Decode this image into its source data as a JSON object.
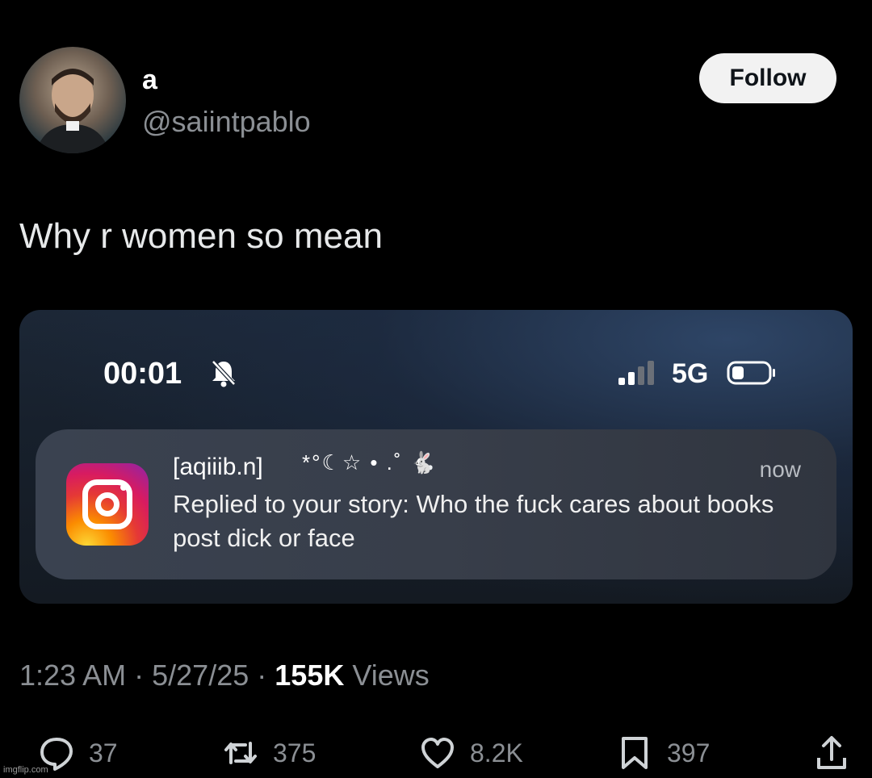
{
  "author": {
    "display_name": "a",
    "handle": "@saiintpablo",
    "follow_label": "Follow"
  },
  "tweet": {
    "text": "Why r women so mean"
  },
  "media": {
    "status_time": "00:01",
    "network": "5G",
    "notification": {
      "app": "Instagram",
      "sender": "[aqiiib.n]",
      "decoration": "*°☾☆ • .˚ 🐇",
      "time": "now",
      "body": "Replied to your story: Who the fuck cares about books post dick or face"
    }
  },
  "meta": {
    "time": "1:23 AM",
    "sep1": "·",
    "date": "5/27/25",
    "sep2": "·",
    "views_count": "155K",
    "views_label": "Views"
  },
  "actions": {
    "replies": "37",
    "reposts": "375",
    "likes": "8.2K",
    "bookmarks": "397"
  },
  "watermark": "imgflip.com",
  "colors": {
    "background": "#000000",
    "text_primary": "#e7e9ea",
    "text_secondary": "#8b8f94",
    "follow_bg": "#f2f2f2"
  },
  "icons": [
    "avatar-photo",
    "bell-slash-icon",
    "signal-icon",
    "battery-icon",
    "instagram-icon",
    "reply-icon",
    "repost-icon",
    "like-icon",
    "bookmark-icon",
    "share-icon"
  ]
}
